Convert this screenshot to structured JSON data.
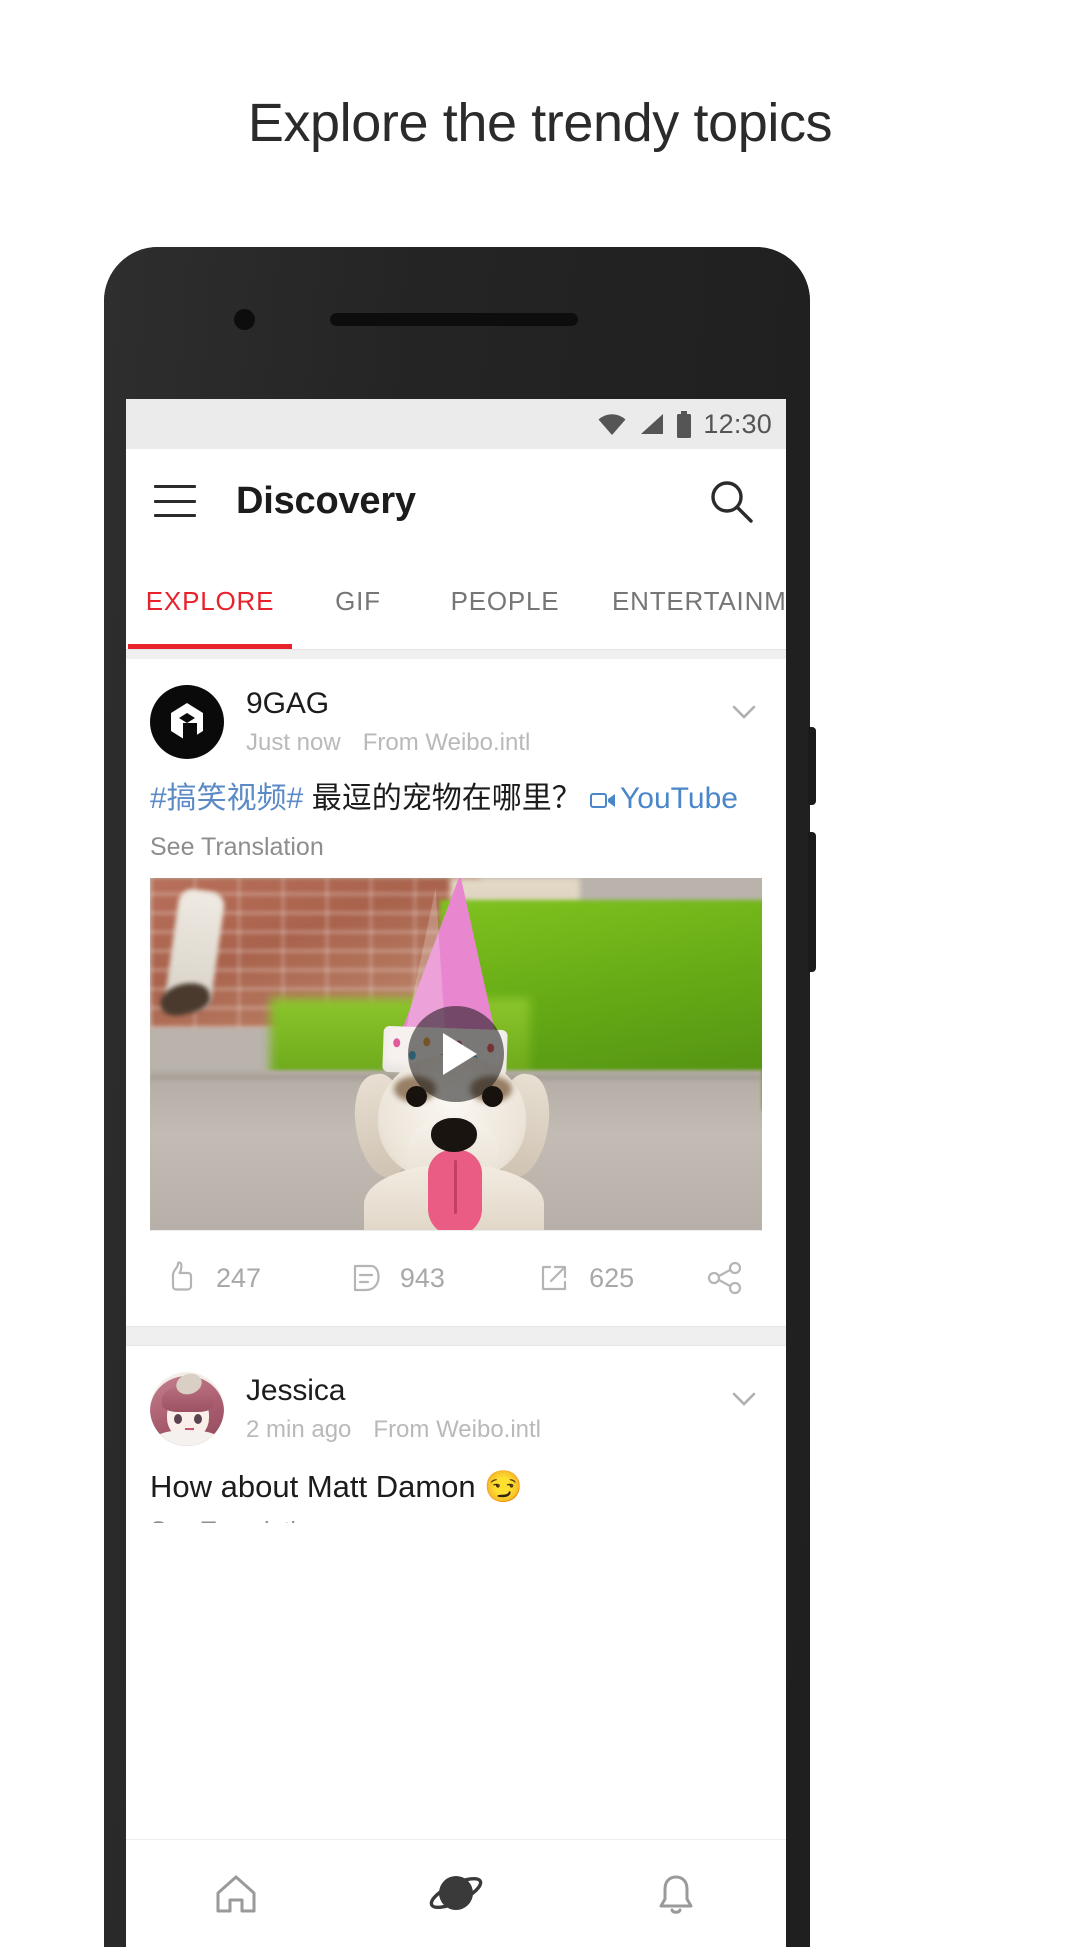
{
  "headline": "Explore the trendy topics",
  "statusbar": {
    "time": "12:30",
    "icons": [
      "wifi-icon",
      "cellular-signal-icon",
      "battery-icon"
    ]
  },
  "appbar": {
    "menu_icon": "hamburger-menu-icon",
    "title": "Discovery",
    "search_icon": "search-icon"
  },
  "tabs": [
    {
      "label": "EXPLORE",
      "active": true
    },
    {
      "label": "GIF",
      "active": false
    },
    {
      "label": "PEOPLE",
      "active": false
    },
    {
      "label": "ENTERTAINME",
      "active": false
    }
  ],
  "colors": {
    "accent_red": "#e8222a",
    "link_blue": "#4a86c8",
    "hashtag_blue": "#5b8ac6",
    "muted_gray": "#b9b9b9"
  },
  "posts": [
    {
      "author": "9GAG",
      "avatar": "9gag-logo-avatar",
      "time": "Just now",
      "source": "From Weibo.intl",
      "hashtag": "#搞笑视频#",
      "body": " 最逗的宠物在哪里？ ",
      "link_label": "YouTube",
      "link_icon": "video-camera-icon",
      "translation_label": "See Translation",
      "media": {
        "type": "video",
        "play_icon": "play-button-icon",
        "description": "White dog wearing a pink party hat on pavement with brick wall and grass"
      },
      "actions": [
        {
          "icon": "thumbs-up-icon",
          "count": "247"
        },
        {
          "icon": "comment-icon",
          "count": "943"
        },
        {
          "icon": "repost-icon",
          "count": "625"
        },
        {
          "icon": "share-icon",
          "count": ""
        }
      ],
      "more_icon": "chevron-down-icon"
    },
    {
      "author": "Jessica",
      "avatar": "anime-girl-avatar",
      "time": "2 min ago",
      "source": "From Weibo.intl",
      "body": "How about Matt Damon ",
      "emoji": "😏",
      "translation_label": "See Translation",
      "more_icon": "chevron-down-icon"
    }
  ],
  "bottomnav": [
    {
      "icon": "home-icon",
      "active": false
    },
    {
      "icon": "planet-discovery-icon",
      "active": true
    },
    {
      "icon": "bell-notifications-icon",
      "active": false
    }
  ]
}
